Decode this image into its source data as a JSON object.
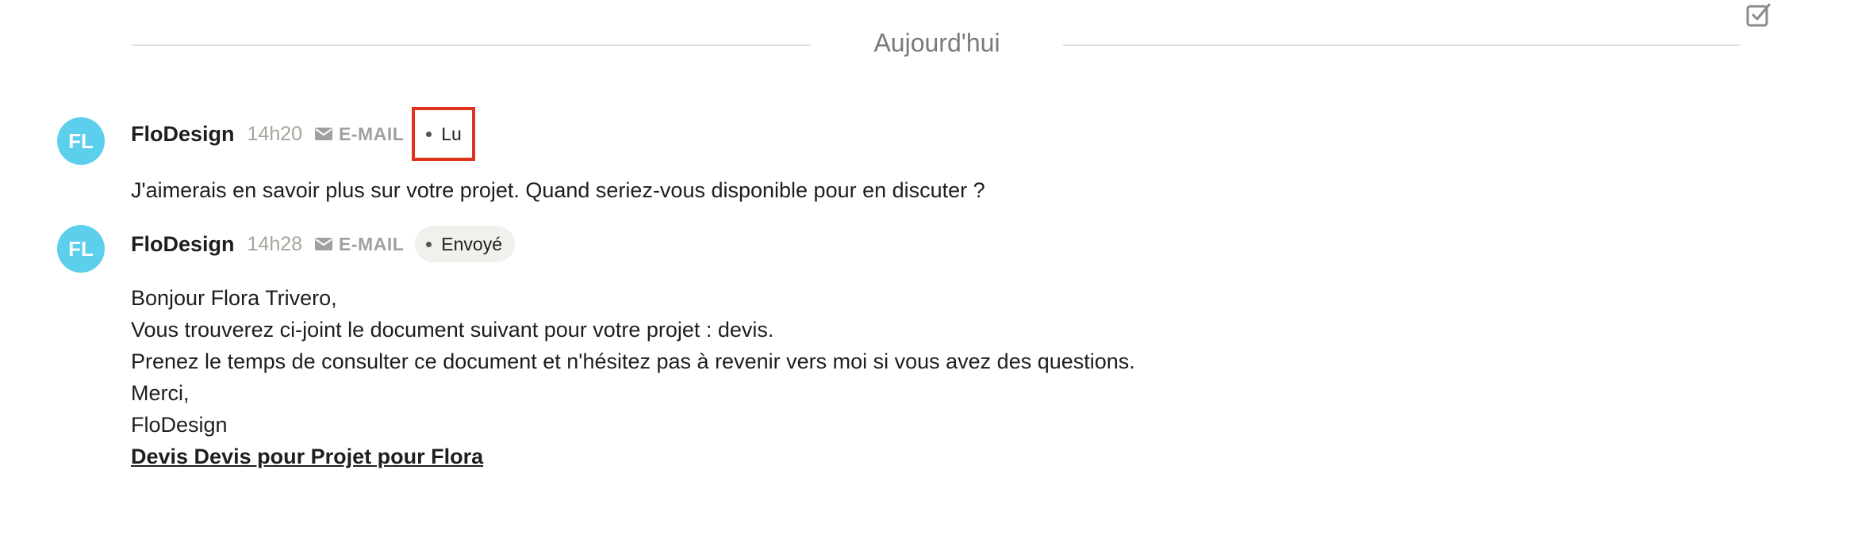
{
  "divider": {
    "label": "Aujourd'hui"
  },
  "toolbar": {
    "corner_icon": "checkbox-edit-icon"
  },
  "messages": [
    {
      "avatar_initials": "FL",
      "sender": "FloDesign",
      "time": "14h20",
      "channel": "E-MAIL",
      "status": "Lu",
      "body": [
        "J'aimerais en savoir plus sur votre projet. Quand seriez-vous disponible pour en discuter ?"
      ]
    },
    {
      "avatar_initials": "FL",
      "sender": "FloDesign",
      "time": "14h28",
      "channel": "E-MAIL",
      "status": "Envoyé",
      "body": [
        "Bonjour Flora Trivero,",
        "Vous trouverez ci-joint le document suivant pour votre projet : devis.",
        "Prenez le temps de consulter ce document et n'hésitez pas à revenir vers moi si vous avez des questions.",
        "Merci,",
        "FloDesign"
      ],
      "attachment_link": "Devis Devis pour Projet pour Flora"
    }
  ],
  "colors": {
    "avatar": "#5ccfec",
    "highlight": "#e0321c",
    "badge_bg": "#f2f0ec",
    "muted_text": "#a8a49a"
  }
}
